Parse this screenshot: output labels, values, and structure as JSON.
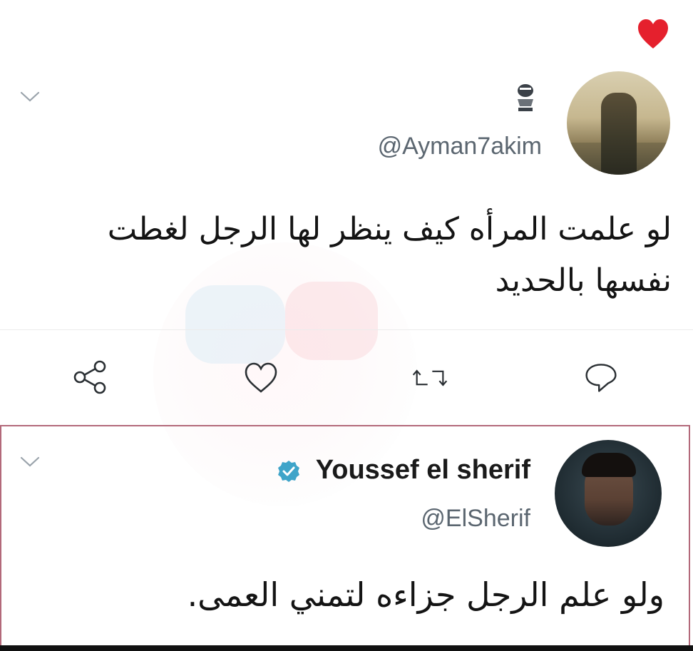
{
  "tweet1": {
    "handle": "@Ayman7akim",
    "text_line1": "لو علمت المرأه  كيف ينظر لها الرجل لغطت",
    "text_line2": "نفسها بالحديد"
  },
  "actions": {
    "share_icon": "share-icon",
    "like_icon": "heart-outline-icon",
    "retweet_icon": "retweet-icon",
    "reply_icon": "reply-bubble-icon"
  },
  "tweet2": {
    "display_name": "Youssef el sherif",
    "handle": "@ElSherif",
    "verified": true,
    "text": "ولو علم الرجل جزاءه لتمني العمى."
  },
  "colors": {
    "heart": "#e5202d",
    "verified": "#3fa4c9",
    "reply_border": "#b3697a",
    "handle": "#5b6670"
  }
}
